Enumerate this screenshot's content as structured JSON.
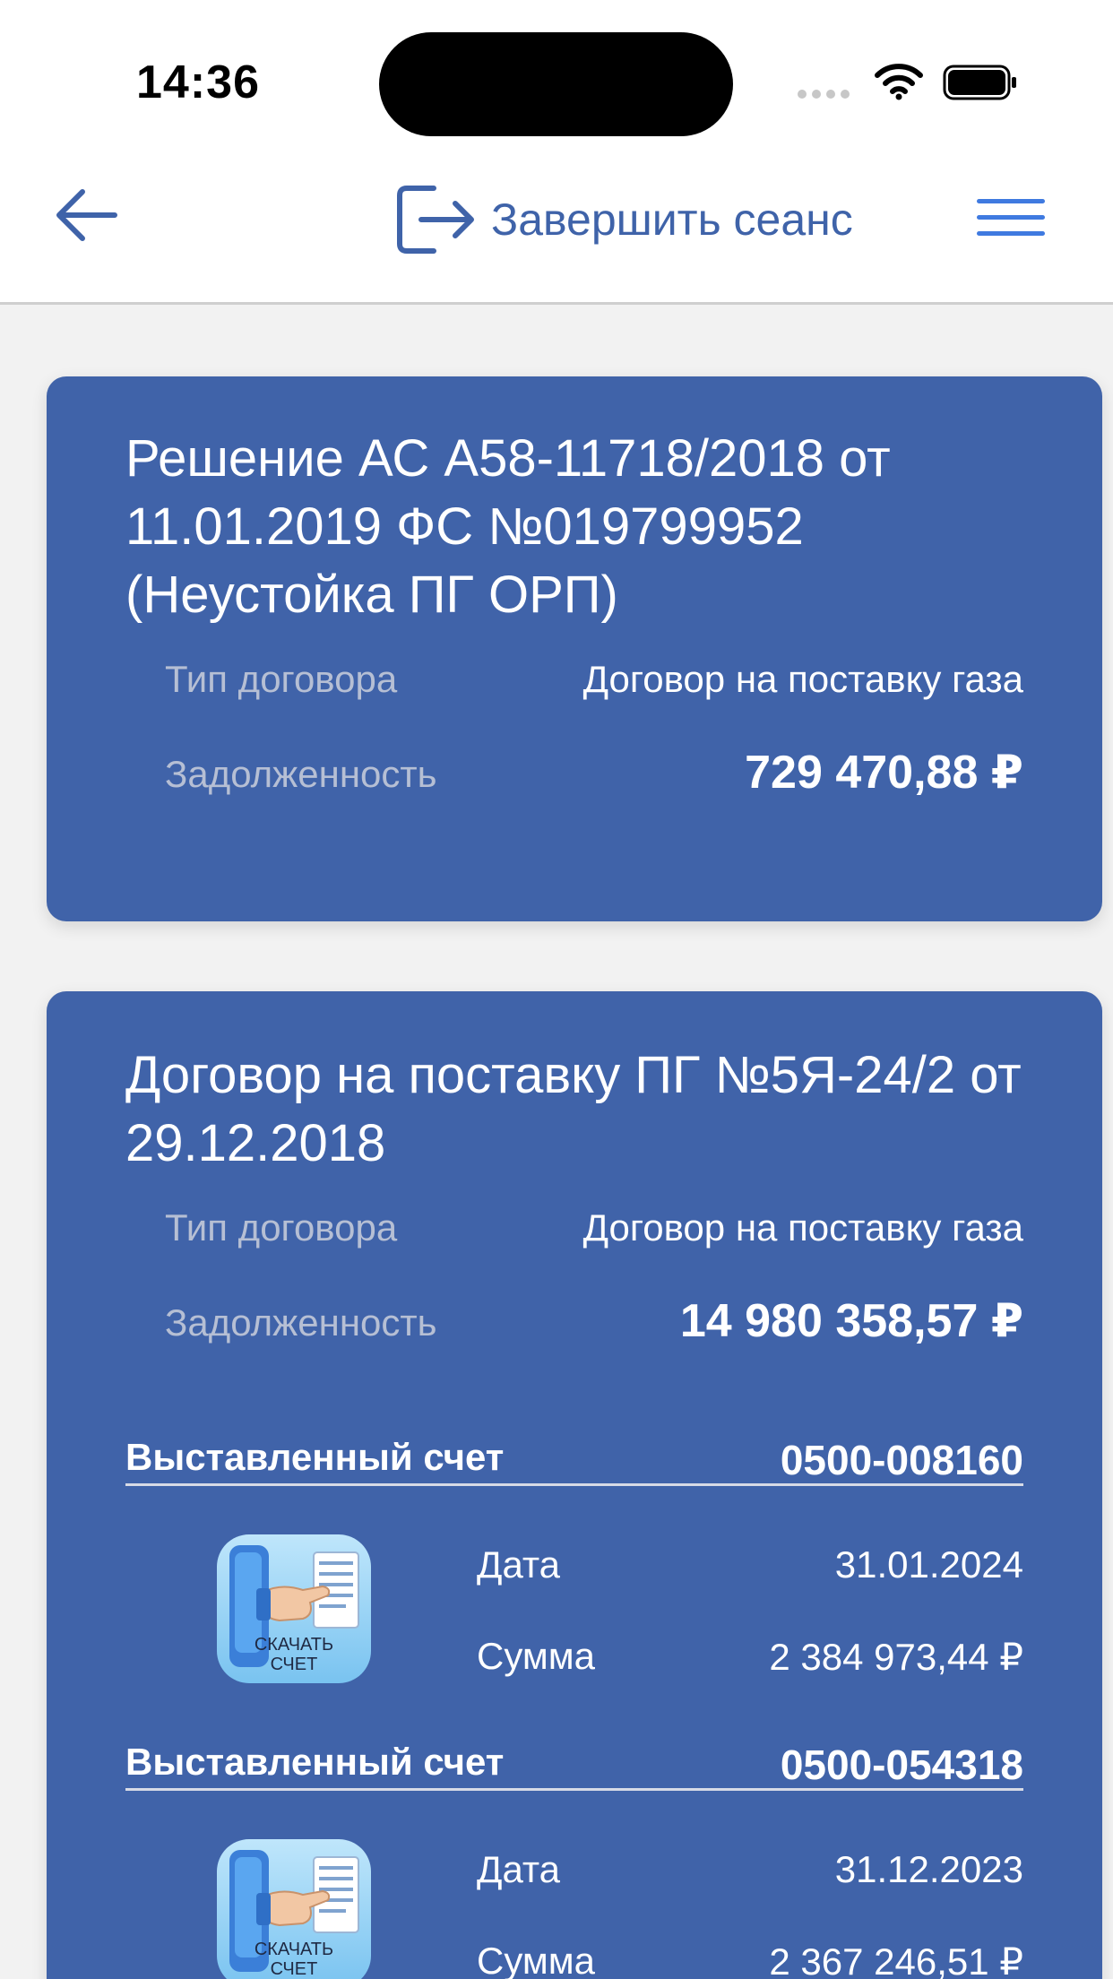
{
  "status_bar": {
    "time": "14:36"
  },
  "header": {
    "logout_label": "Завершить сеанс"
  },
  "contracts": [
    {
      "title": "Решение АС А58-11718/2018 от 11.01.2019 ФС №019799952 (Неустойка ПГ ОРП)",
      "type_label": "Тип договора",
      "type_value": "Договор на поставку газа",
      "debt_label": "Задолженность",
      "debt_value": "729 470,88 ₽"
    },
    {
      "title": "Договор на поставку ПГ №5Я-24/2 от 29.12.2018",
      "type_label": "Тип договора",
      "type_value": "Договор на поставку газа",
      "debt_label": "Задолженность",
      "debt_value": "14 980 358,57 ₽",
      "invoices": [
        {
          "label": "Выставленный счет",
          "number": "0500-008160",
          "download_line1": "СКАЧАТЬ",
          "download_line2": "СЧЕТ",
          "date_label": "Дата",
          "date_value": "31.01.2024",
          "sum_label": "Сумма",
          "sum_value": "2 384 973,44 ₽"
        },
        {
          "label": "Выставленный счет",
          "number": "0500-054318",
          "download_line1": "СКАЧАТЬ",
          "download_line2": "СЧЕТ",
          "date_label": "Дата",
          "date_value": "31.12.2023",
          "sum_label": "Сумма",
          "sum_value": "2 367 246,51 ₽"
        }
      ]
    }
  ],
  "colors": {
    "card": "#4063a9",
    "accent": "#3f63a9",
    "menu": "#3f7ae0"
  }
}
